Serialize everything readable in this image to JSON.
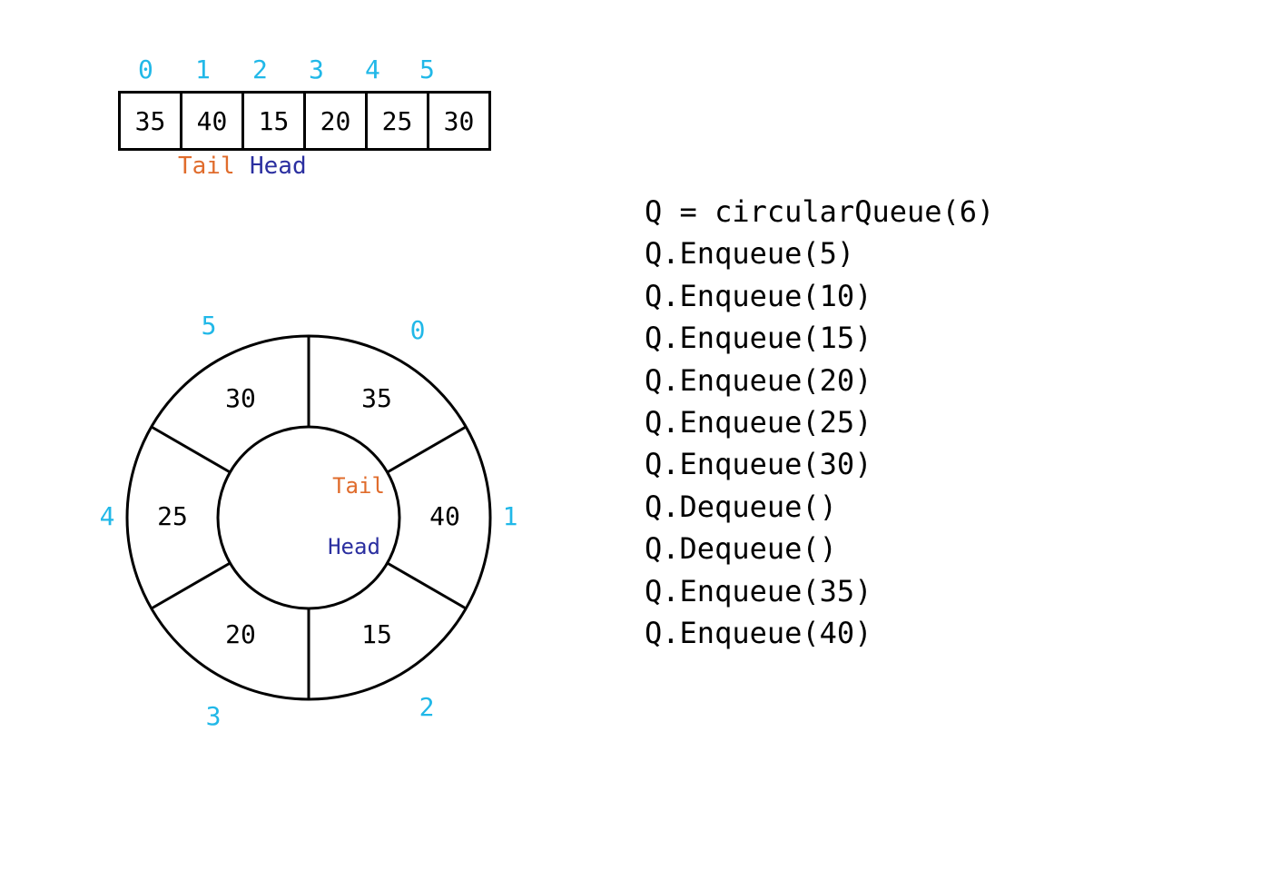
{
  "array": {
    "indices": [
      "0",
      "1",
      "2",
      "3",
      "4",
      "5"
    ],
    "values": [
      "35",
      "40",
      "15",
      "20",
      "25",
      "30"
    ],
    "tailLabel": "Tail",
    "headLabel": "Head"
  },
  "ring": {
    "sectors": [
      {
        "idx": "0",
        "val": "35"
      },
      {
        "idx": "1",
        "val": "40"
      },
      {
        "idx": "2",
        "val": "15"
      },
      {
        "idx": "3",
        "val": "20"
      },
      {
        "idx": "4",
        "val": "25"
      },
      {
        "idx": "5",
        "val": "30"
      }
    ],
    "tailLabel": "Tail",
    "headLabel": "Head"
  },
  "code": [
    "Q = circularQueue(6)",
    "Q.Enqueue(5)",
    "Q.Enqueue(10)",
    "Q.Enqueue(15)",
    "Q.Enqueue(20)",
    "Q.Enqueue(25)",
    "Q.Enqueue(30)",
    "Q.Dequeue()",
    "Q.Dequeue()",
    "Q.Enqueue(35)",
    "Q.Enqueue(40)"
  ],
  "chart_data": {
    "type": "table",
    "title": "Circular queue state after operations",
    "size": 6,
    "head_index": 2,
    "tail_index": 1,
    "slots": [
      {
        "index": 0,
        "value": 35
      },
      {
        "index": 1,
        "value": 40
      },
      {
        "index": 2,
        "value": 15
      },
      {
        "index": 3,
        "value": 20
      },
      {
        "index": 4,
        "value": 25
      },
      {
        "index": 5,
        "value": 30
      }
    ]
  }
}
